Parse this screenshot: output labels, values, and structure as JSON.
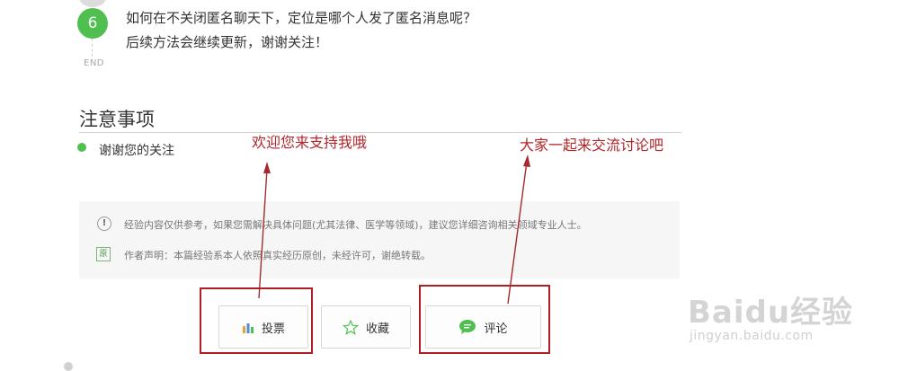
{
  "step": {
    "number": "6",
    "end_label": "END",
    "line1": "如何在不关闭匿名聊天下，定位是哪个人发了匿名消息呢？",
    "line2": "后续方法会继续更新，谢谢关注！"
  },
  "notes": {
    "title": "注意事项",
    "items": [
      "谢谢您的关注"
    ]
  },
  "annotations": {
    "left": "欢迎您来支持我哦",
    "right": "大家一起来交流讨论吧"
  },
  "disclaimer": {
    "icon1": "!",
    "line1": "经验内容仅供参考，如果您需解决具体问题(尤其法律、医学等领域)，建议您详细咨询相关领域专业人士。",
    "icon2": "原",
    "line2": "作者声明：本篇经验系本人依照真实经历原创，未经许可，谢绝转载。"
  },
  "actions": {
    "vote": "投票",
    "collect": "收藏",
    "comment": "评论"
  },
  "watermark": {
    "main": "Baidu经验",
    "sub": "jingyan.baidu.com"
  },
  "colors": {
    "accent_green": "#4fc04f",
    "annotation_red": "#b2252a"
  },
  "icons": {
    "vote": "bar-chart-icon",
    "collect": "star-outline-icon",
    "comment": "speech-bubble-icon",
    "disclaimer1": "exclamation-circle-icon",
    "disclaimer2": "original-badge-icon"
  }
}
